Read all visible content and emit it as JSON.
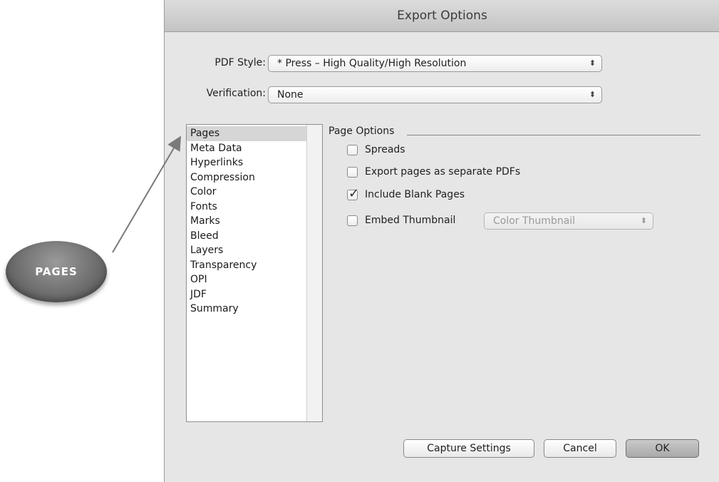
{
  "dialog": {
    "title": "Export Options"
  },
  "pdf_style": {
    "label": "PDF Style:",
    "value": "* Press – High Quality/High Resolution"
  },
  "verification": {
    "label": "Verification:",
    "value": "None"
  },
  "sidebar": {
    "items": [
      {
        "label": "Pages",
        "selected": true
      },
      {
        "label": "Meta Data"
      },
      {
        "label": "Hyperlinks"
      },
      {
        "label": "Compression"
      },
      {
        "label": "Color"
      },
      {
        "label": "Fonts"
      },
      {
        "label": "Marks"
      },
      {
        "label": "Bleed"
      },
      {
        "label": "Layers"
      },
      {
        "label": "Transparency"
      },
      {
        "label": "OPI"
      },
      {
        "label": "JDF"
      },
      {
        "label": "Summary"
      }
    ]
  },
  "page_options": {
    "title": "Page Options",
    "spreads": {
      "label": "Spreads",
      "checked": false
    },
    "separate_pdfs": {
      "label": "Export pages as separate PDFs",
      "checked": false
    },
    "blank_pages": {
      "label": "Include Blank Pages",
      "checked": true
    },
    "embed_thumbnail": {
      "label": "Embed Thumbnail",
      "checked": false
    },
    "thumbnail_type": {
      "value": "Color Thumbnail",
      "enabled": false
    }
  },
  "buttons": {
    "capture": "Capture Settings",
    "cancel": "Cancel",
    "ok": "OK"
  },
  "callout": {
    "label": "PAGES"
  },
  "icons": {
    "popup_arrows": "⬍",
    "check_mark": "✓"
  },
  "colors": {
    "dialog_bg": "#e6e6e6",
    "callout": "#6f6f6f",
    "selected_row": "#d6d6d6"
  }
}
